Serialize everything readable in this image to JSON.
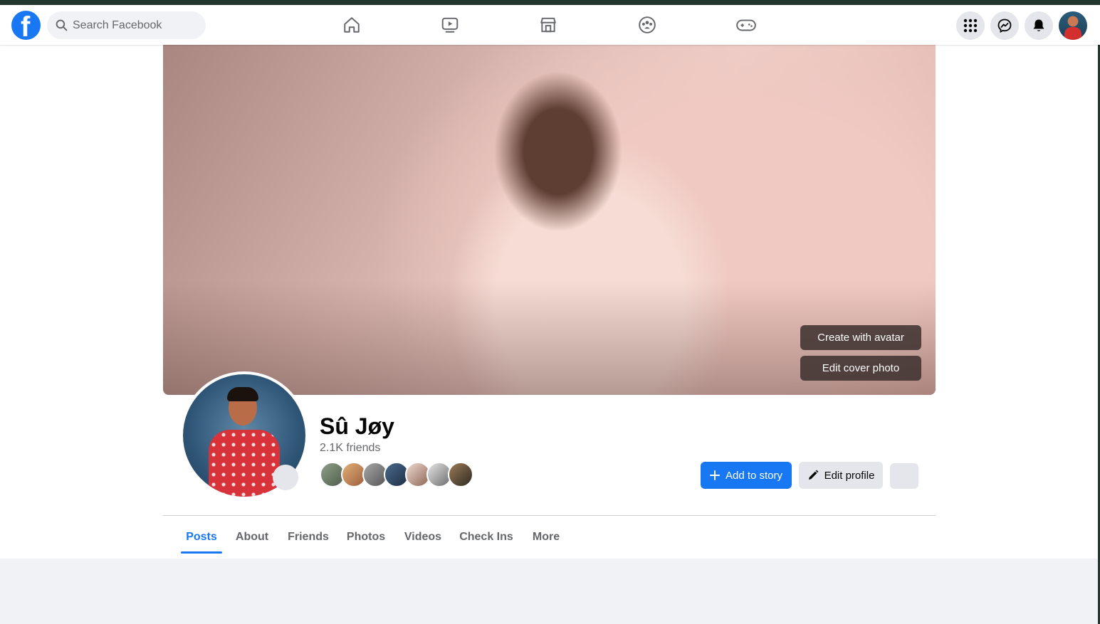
{
  "colors": {
    "brand": "#1877f2",
    "muted_text": "#65676b",
    "button_gray": "#e4e6eb"
  },
  "navbar": {
    "logo_letter": "f",
    "search": {
      "placeholder": "Search Facebook"
    },
    "nav_icons": [
      "home-icon",
      "watch-icon",
      "marketplace-icon",
      "groups-icon",
      "gaming-icon"
    ],
    "right_icons": [
      "menu-grid-icon",
      "messenger-icon",
      "notifications-icon"
    ]
  },
  "cover": {
    "create_avatar_label": "Create with avatar",
    "edit_cover_label": "Edit cover photo"
  },
  "profile": {
    "name": "Sû Jøy",
    "friends_count": "2.1K friends",
    "friend_avatars_count": 7
  },
  "actions": {
    "add_story_label": "Add to story",
    "edit_profile_label": "Edit profile"
  },
  "tabs": [
    {
      "label": "Posts",
      "active": true
    },
    {
      "label": "About"
    },
    {
      "label": "Friends"
    },
    {
      "label": "Photos"
    },
    {
      "label": "Videos"
    },
    {
      "label": "Check Ins"
    },
    {
      "label": "More"
    }
  ]
}
